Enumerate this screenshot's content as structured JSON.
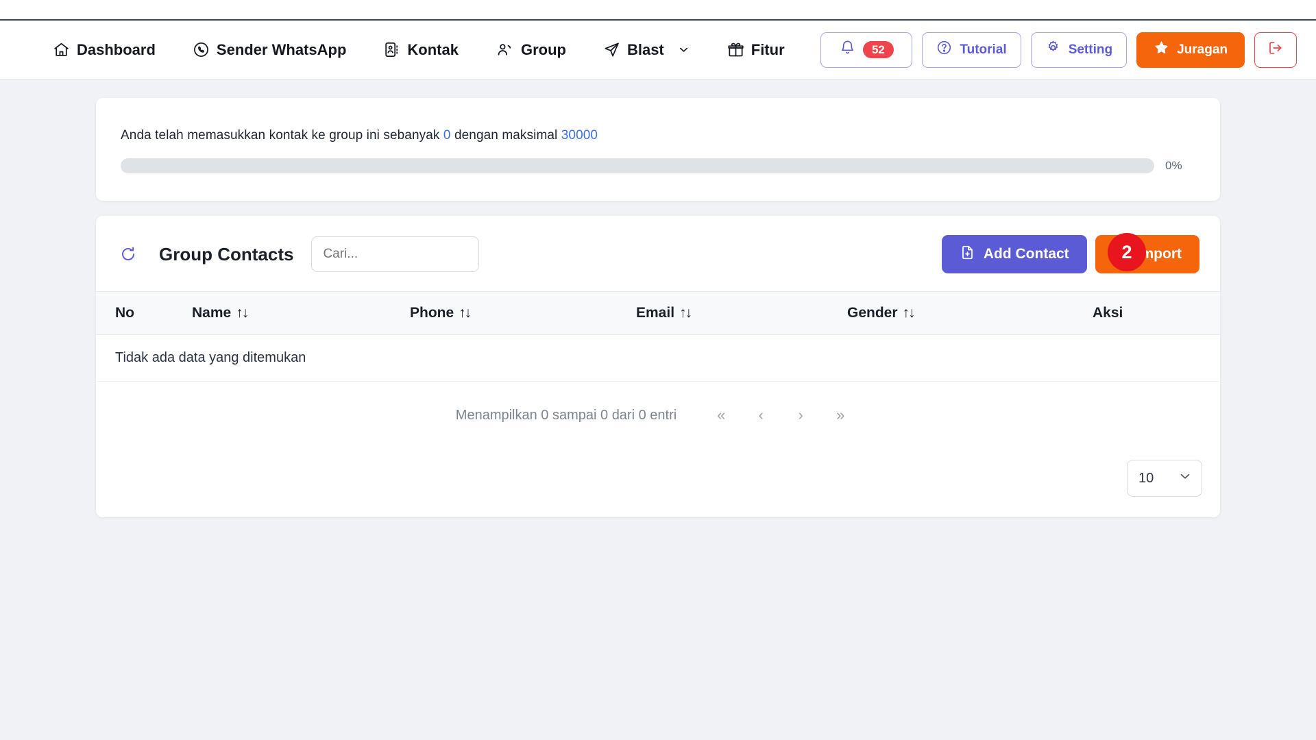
{
  "navbar": {
    "items": [
      {
        "label": "Dashboard",
        "icon": "home-icon"
      },
      {
        "label": "Sender WhatsApp",
        "icon": "whatsapp-icon"
      },
      {
        "label": "Kontak",
        "icon": "contact-card-icon"
      },
      {
        "label": "Group",
        "icon": "users-icon"
      },
      {
        "label": "Blast",
        "icon": "send-icon",
        "caret": true
      },
      {
        "label": "Fitur",
        "icon": "gift-icon"
      }
    ],
    "actions": {
      "notification_count": "52",
      "tutorial_label": "Tutorial",
      "setting_label": "Setting",
      "juragan_label": "Juragan"
    }
  },
  "quota": {
    "text_before": "Anda telah memasukkan kontak ke group ini sebanyak",
    "current": "0",
    "text_middle": "dengan maksimal",
    "max": "30000",
    "progress_percent": "0%",
    "progress_value": 0
  },
  "contacts": {
    "title": "Group Contacts",
    "search_placeholder": "Cari...",
    "add_button": "Add Contact",
    "import_button": "Import",
    "marker_label": "2",
    "columns": [
      {
        "label": "No",
        "sortable": false
      },
      {
        "label": "Name",
        "sortable": true
      },
      {
        "label": "Phone",
        "sortable": true
      },
      {
        "label": "Email",
        "sortable": true
      },
      {
        "label": "Gender",
        "sortable": true
      },
      {
        "label": "Aksi",
        "sortable": false
      }
    ],
    "empty_message": "Tidak ada data yang ditemukan",
    "pagination": {
      "info": "Menampilkan 0 sampai 0 dari 0 entri",
      "first": "«",
      "prev": "‹",
      "next": "›",
      "last": "»"
    },
    "page_size": "10"
  },
  "colors": {
    "accent_purple": "#5b5bd6",
    "accent_orange": "#f4650c",
    "danger_red": "#f0444c",
    "marker_red": "#e8151f",
    "link_blue": "#3b6fe0"
  }
}
